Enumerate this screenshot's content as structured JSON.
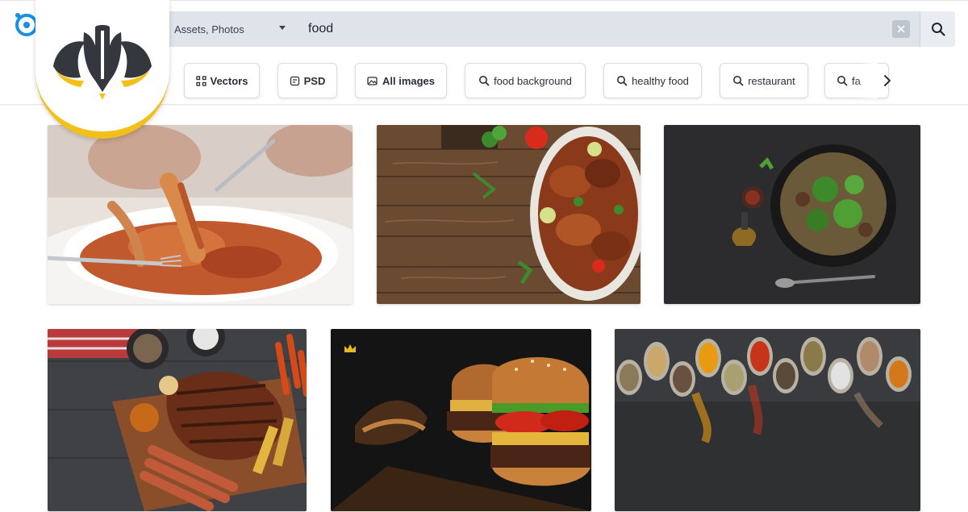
{
  "search": {
    "asset_type": "Assets, Photos",
    "query": "food"
  },
  "filters": {
    "chips": [
      {
        "label": "Vectors",
        "icon": "vector-icon"
      },
      {
        "label": "PSD",
        "icon": "psd-icon"
      },
      {
        "label": "All images",
        "icon": "images-icon"
      },
      {
        "label": "food background",
        "icon": "search-icon"
      },
      {
        "label": "healthy food",
        "icon": "search-icon"
      },
      {
        "label": "restaurant",
        "icon": "search-icon"
      },
      {
        "label": "fa",
        "icon": "search-icon"
      }
    ]
  },
  "results": {
    "images": [
      {
        "subject": "pasta-bolognese",
        "premium": false
      },
      {
        "subject": "grilled-chicken-wood",
        "premium": false
      },
      {
        "subject": "vegetable-bowl-dark",
        "premium": false
      },
      {
        "subject": "grilled-steak-board",
        "premium": false
      },
      {
        "subject": "burger-dark",
        "premium": true
      },
      {
        "subject": "spices-in-spoons",
        "premium": false
      }
    ]
  },
  "colors": {
    "badge_accent": "#f3c01a",
    "badge_dark": "#34373e",
    "crown": "#e8b923",
    "logo_blue": "#1a8fe3"
  }
}
